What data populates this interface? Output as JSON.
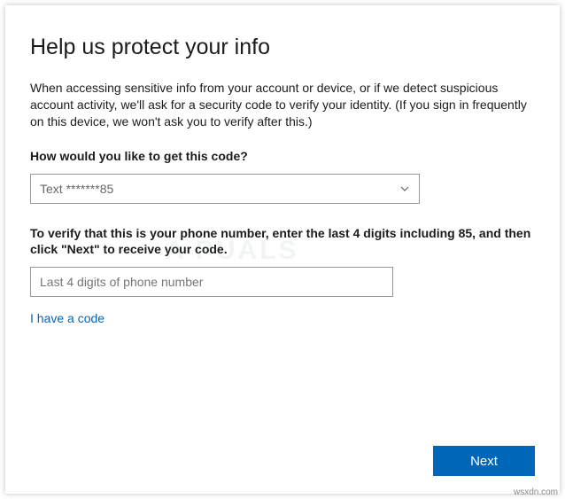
{
  "title": "Help us protect your info",
  "intro": "When accessing sensitive info from your account or device, or if we detect suspicious account activity, we'll ask for a security code to verify your identity. (If you sign in frequently on this device, we won't ask you to verify after this.)",
  "method_label": "How would you like to get this code?",
  "dropdown_value": "Text *******85",
  "verify_instruction": "To verify that this is your phone number, enter the last 4 digits including 85, and then click \"Next\" to receive your code.",
  "digits_placeholder": "Last 4 digits of phone number",
  "have_code_link": "I have a code",
  "next_button": "Next",
  "attribution": "wsxdn.com",
  "watermark": "A   PUALS"
}
